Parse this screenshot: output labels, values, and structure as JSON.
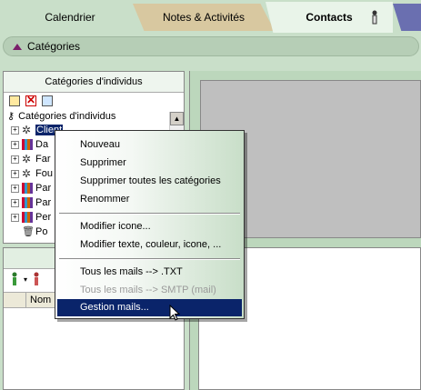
{
  "tabs": {
    "calendrier": "Calendrier",
    "notes": "Notes & Activités",
    "contacts": "Contacts"
  },
  "categories_bar": {
    "label": "Catégories"
  },
  "left_panel": {
    "header": "Catégories d'individus",
    "tree": {
      "root": "Catégories d'individus",
      "items": [
        {
          "label": "Client",
          "icon": "gear-icon",
          "selected": true
        },
        {
          "label": "Da",
          "icon": "bars-icon"
        },
        {
          "label": "Far",
          "icon": "gear-icon"
        },
        {
          "label": "Fou",
          "icon": "gear-icon"
        },
        {
          "label": "Par",
          "icon": "bars-icon"
        },
        {
          "label": "Par",
          "icon": "bars-icon"
        },
        {
          "label": "Per",
          "icon": "bars-icon"
        },
        {
          "label": "Po",
          "icon": "trash-icon"
        }
      ]
    }
  },
  "bottom_left": {
    "columns": [
      "Nom"
    ]
  },
  "context_menu": {
    "items": [
      {
        "label": "Nouveau"
      },
      {
        "label": "Supprimer"
      },
      {
        "label": "Supprimer toutes les catégories"
      },
      {
        "label": "Renommer"
      },
      {
        "label": "Modifier icone..."
      },
      {
        "label": "Modifier texte, couleur, icone, ..."
      },
      {
        "label": "Tous les mails --> .TXT"
      },
      {
        "label": "Tous les mails --> SMTP (mail)",
        "disabled": true
      },
      {
        "label": "Gestion mails...",
        "active": true
      }
    ]
  },
  "colors": {
    "background": "#c9dfc9",
    "selection": "#0a246a",
    "notes_tab": "#d8c8a0",
    "gray_panel": "#bfbfbf"
  }
}
